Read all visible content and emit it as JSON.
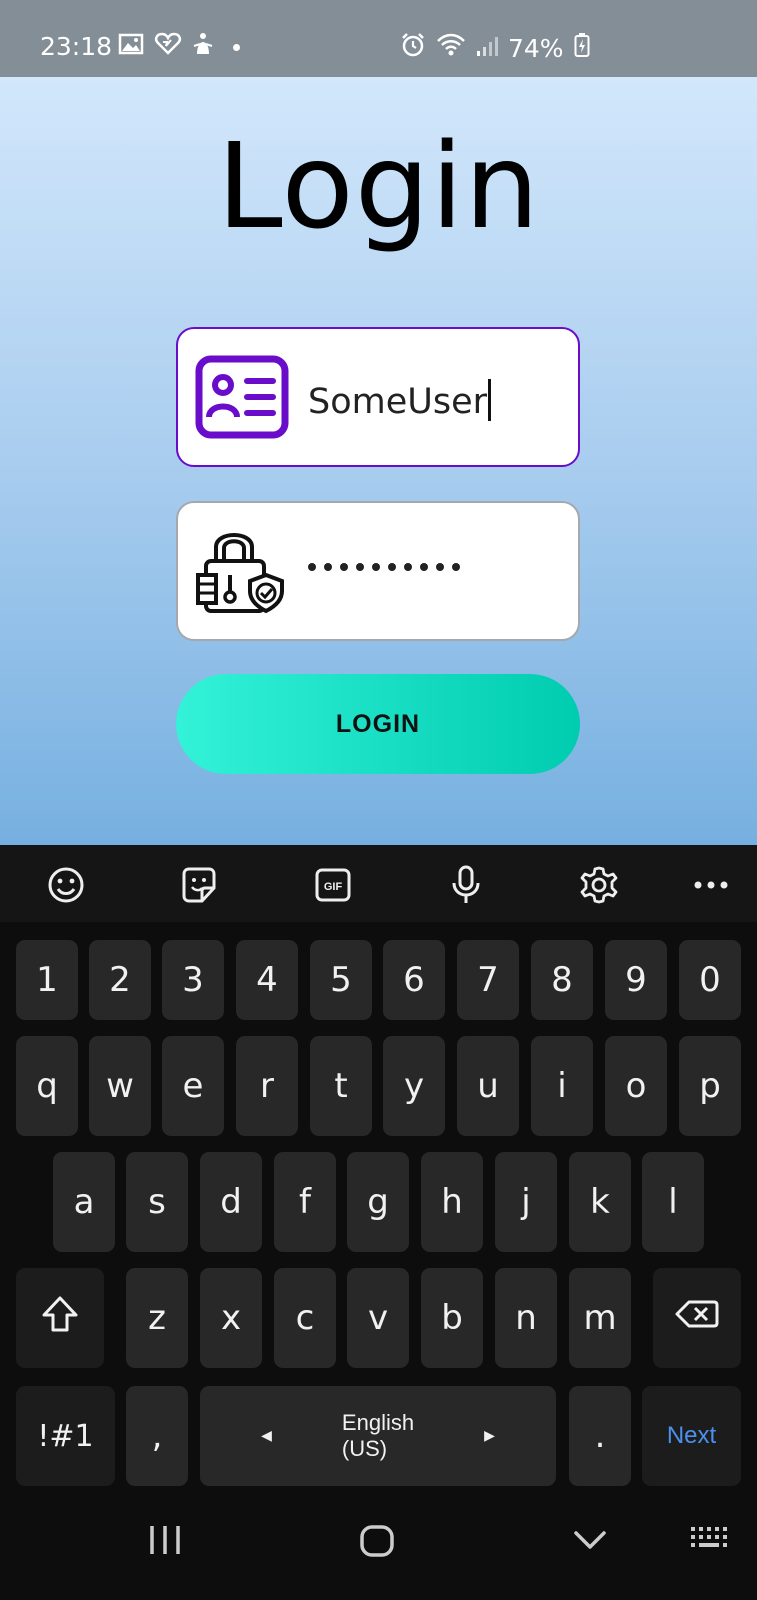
{
  "status_bar": {
    "time": "23:18",
    "battery_percent": "74%",
    "icons": [
      "gallery-icon",
      "heart-icon",
      "accessibility-icon",
      "alarm-icon",
      "wifi-icon",
      "signal-icon",
      "battery-charging-icon"
    ]
  },
  "app": {
    "title": "Login",
    "username_value": "SomeUser",
    "password_mask": "••••••••••",
    "login_label": "LOGIN",
    "colors": {
      "focus_border": "#6a0dca",
      "button_start": "#33f2d8",
      "button_end": "#00ccb0"
    }
  },
  "keyboard": {
    "toolbar": [
      "emoji-icon",
      "sticker-icon",
      "gif-icon",
      "microphone-icon",
      "settings-icon",
      "more-icon"
    ],
    "number_row": [
      "1",
      "2",
      "3",
      "4",
      "5",
      "6",
      "7",
      "8",
      "9",
      "0"
    ],
    "row1": [
      "q",
      "w",
      "e",
      "r",
      "t",
      "y",
      "u",
      "i",
      "o",
      "p"
    ],
    "row2": [
      "a",
      "s",
      "d",
      "f",
      "g",
      "h",
      "j",
      "k",
      "l"
    ],
    "row3": [
      "z",
      "x",
      "c",
      "v",
      "b",
      "n",
      "m"
    ],
    "symbols_label": "!#1",
    "comma": ",",
    "space_label": "English (US)",
    "period": ".",
    "next_label": "Next",
    "next_color": "#4a90ee"
  },
  "nav_bar": {
    "buttons": [
      "recents-icon",
      "home-icon",
      "back-icon",
      "keyboard-switch-icon"
    ]
  }
}
